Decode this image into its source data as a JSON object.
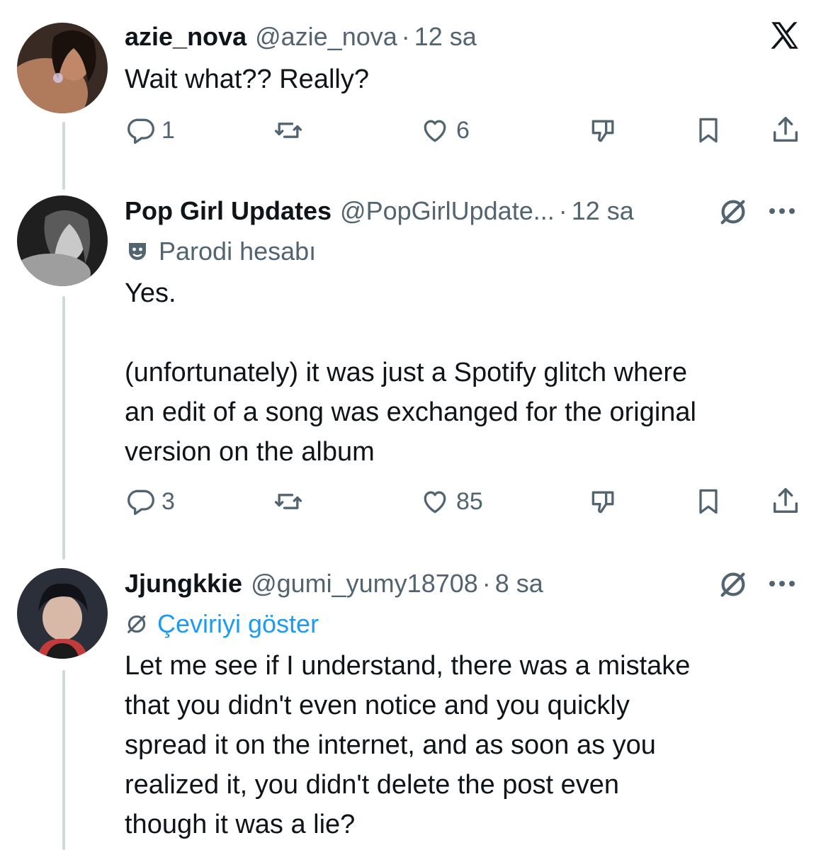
{
  "header": {
    "logo_icon": "x-logo-icon"
  },
  "posts": [
    {
      "display_name": "azie_nova",
      "handle": "@azie_nova",
      "separator": "·",
      "time": "12 sa",
      "text": "Wait what?? Really?",
      "actions": {
        "replies": "1",
        "reposts": "",
        "likes": "6"
      }
    },
    {
      "display_name": "Pop Girl Updates",
      "handle": "@PopGirlUpdate...",
      "separator": "·",
      "time": "12 sa",
      "badge": "Parodi hesabı",
      "text": "Yes.\n\n(unfortunately) it was just a Spotify glitch where\nan edit of a song was exchanged for the original\nversion on the album",
      "actions": {
        "replies": "3",
        "reposts": "",
        "likes": "85"
      }
    },
    {
      "display_name": "Jjungkkie",
      "handle": "@gumi_yumy18708",
      "separator": "·",
      "time": "8 sa",
      "translate_label": "Çeviriyi göster",
      "text": "Let me see if I understand, there was a mistake\nthat you didn't even notice and you quickly\nspread it on the internet, and as soon as you\nrealized it, you didn't delete the post even\nthough it was a lie?"
    }
  ],
  "colors": {
    "text": "#0f1419",
    "secondary": "#536471",
    "link": "#1d9bf0",
    "thread_line": "#cfd9de"
  }
}
